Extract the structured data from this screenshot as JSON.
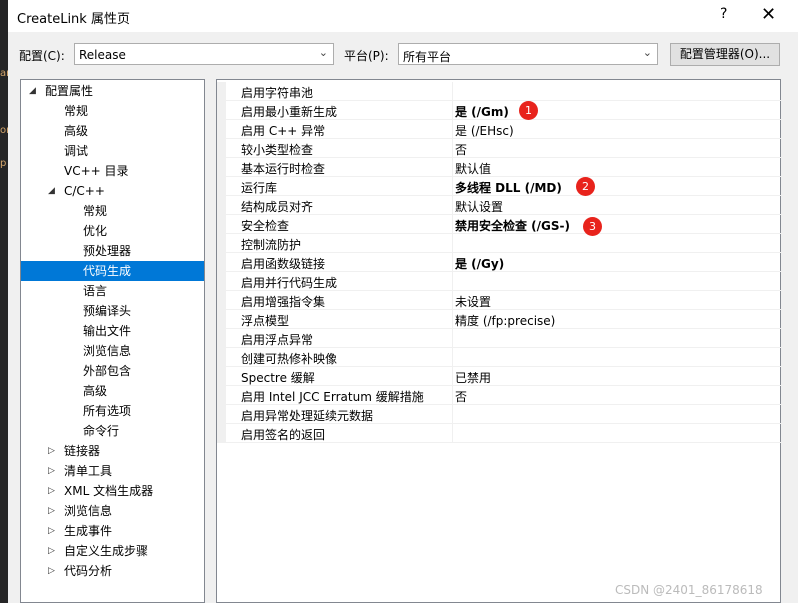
{
  "window": {
    "title": "CreateLink 属性页",
    "help_glyph": "?",
    "close_glyph": "✕"
  },
  "toolbar": {
    "config_label": "配置(C):",
    "config_value": "Release",
    "platform_label": "平台(P):",
    "platform_value": "所有平台",
    "manager_button": "配置管理器(O)...",
    "combo_arrow": "⌄"
  },
  "tree": {
    "expanded_glyph": "◢",
    "collapsed_glyph": "▷",
    "items": [
      {
        "label": "配置属性"
      },
      {
        "label": "常规"
      },
      {
        "label": "高级"
      },
      {
        "label": "调试"
      },
      {
        "label": "VC++ 目录"
      },
      {
        "label": "C/C++"
      },
      {
        "label": "常规"
      },
      {
        "label": "优化"
      },
      {
        "label": "预处理器"
      },
      {
        "label": "代码生成"
      },
      {
        "label": "语言"
      },
      {
        "label": "预编译头"
      },
      {
        "label": "输出文件"
      },
      {
        "label": "浏览信息"
      },
      {
        "label": "外部包含"
      },
      {
        "label": "高级"
      },
      {
        "label": "所有选项"
      },
      {
        "label": "命令行"
      },
      {
        "label": "链接器"
      },
      {
        "label": "清单工具"
      },
      {
        "label": "XML 文档生成器"
      },
      {
        "label": "浏览信息"
      },
      {
        "label": "生成事件"
      },
      {
        "label": "自定义生成步骤"
      },
      {
        "label": "代码分析"
      }
    ],
    "selected_index": 9
  },
  "grid": {
    "rows": [
      {
        "name": "启用字符串池",
        "value": ""
      },
      {
        "name": "启用最小重新生成",
        "value": "是 (/Gm)"
      },
      {
        "name": "启用 C++ 异常",
        "value": "是 (/EHsc)"
      },
      {
        "name": "较小类型检查",
        "value": "否"
      },
      {
        "name": "基本运行时检查",
        "value": "默认值"
      },
      {
        "name": "运行库",
        "value": "多线程 DLL (/MD)"
      },
      {
        "name": "结构成员对齐",
        "value": "默认设置"
      },
      {
        "name": "安全检查",
        "value": "禁用安全检查 (/GS-)"
      },
      {
        "name": "控制流防护",
        "value": ""
      },
      {
        "name": "启用函数级链接",
        "value": "是 (/Gy)"
      },
      {
        "name": "启用并行代码生成",
        "value": ""
      },
      {
        "name": "启用增强指令集",
        "value": "未设置"
      },
      {
        "name": "浮点模型",
        "value": "精度 (/fp:precise)"
      },
      {
        "name": "启用浮点异常",
        "value": ""
      },
      {
        "name": "创建可热修补映像",
        "value": ""
      },
      {
        "name": "Spectre 缓解",
        "value": "已禁用"
      },
      {
        "name": "启用 Intel JCC Erratum 缓解措施",
        "value": "否"
      },
      {
        "name": "启用异常处理延续元数据",
        "value": ""
      },
      {
        "name": "启用签名的返回",
        "value": ""
      }
    ]
  },
  "annotations": [
    "1",
    "2",
    "3"
  ],
  "watermark": "CSDN @2401_86178618",
  "colors": {
    "selection": "#0078d7",
    "badge": "#e8231c"
  }
}
